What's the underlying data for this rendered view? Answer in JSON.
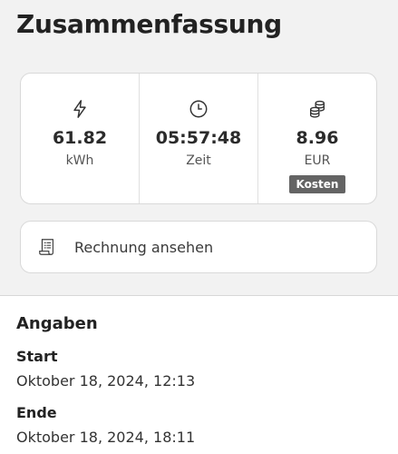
{
  "page_title": "Zusammenfassung",
  "stats": [
    {
      "icon": "lightning-icon",
      "value": "61.82",
      "unit": "kWh"
    },
    {
      "icon": "clock-icon",
      "value": "05:57:48",
      "unit": "Zeit"
    },
    {
      "icon": "coins-icon",
      "value": "8.96",
      "unit": "EUR",
      "badge": "Kosten"
    }
  ],
  "invoice": {
    "icon": "receipt-icon",
    "label": "Rechnung ansehen"
  },
  "details": {
    "section_title": "Angaben",
    "start_label": "Start",
    "start_value": "Oktober 18, 2024, 12:13",
    "end_label": "Ende",
    "end_value": "Oktober 18, 2024, 18:11"
  },
  "colors": {
    "background_top": "#f2f2f2",
    "card": "#ffffff",
    "badge": "#646464",
    "text": "#2b2b2b"
  }
}
